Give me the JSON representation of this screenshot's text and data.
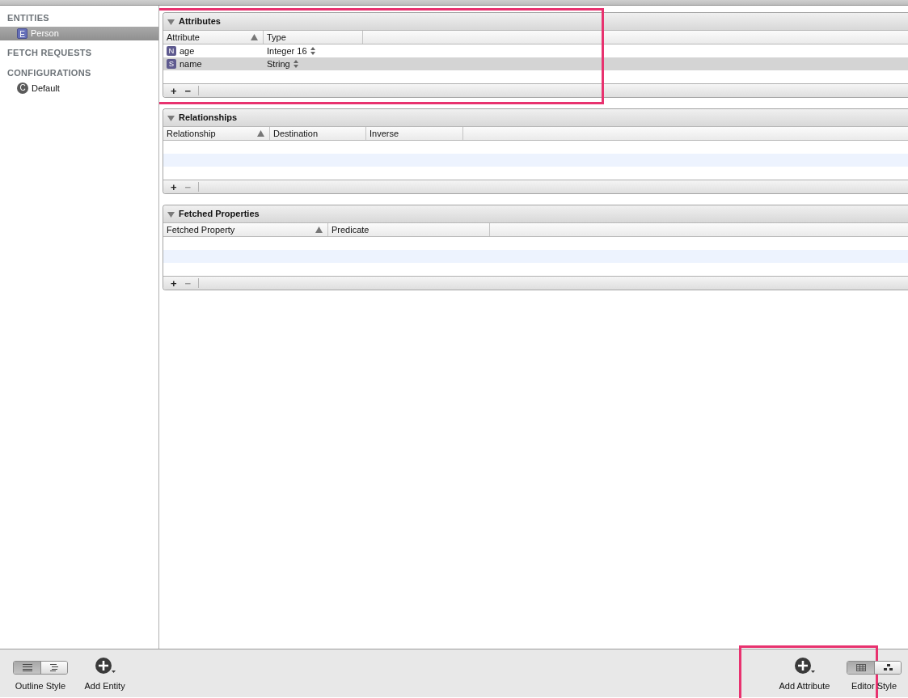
{
  "sidebar": {
    "sections": [
      {
        "title": "ENTITIES",
        "items": [
          {
            "badge": "E",
            "label": "Person",
            "selected": true
          }
        ]
      },
      {
        "title": "FETCH REQUESTS"
      },
      {
        "title": "CONFIGURATIONS",
        "items": [
          {
            "badge": "C",
            "label": "Default",
            "selected": false
          }
        ]
      }
    ]
  },
  "panels": [
    {
      "title": "Attributes",
      "expanded": true,
      "highlighted": true,
      "columns": [
        {
          "label": "Attribute",
          "sorted": true
        },
        {
          "label": "Type",
          "sorted": false
        }
      ],
      "rows": [
        {
          "badge": "N",
          "name": "age",
          "type": "Integer 16",
          "selected": false
        },
        {
          "badge": "S",
          "name": "name",
          "type": "String",
          "selected": true
        }
      ],
      "buttons": [
        {
          "label": "+",
          "disabled": false
        },
        {
          "label": "−",
          "disabled": false
        }
      ]
    },
    {
      "title": "Relationships",
      "expanded": true,
      "highlighted": false,
      "columns": [
        {
          "label": "Relationship",
          "sorted": true
        },
        {
          "label": "Destination",
          "sorted": false
        },
        {
          "label": "Inverse",
          "sorted": false
        }
      ],
      "buttons": [
        {
          "label": "+",
          "disabled": false
        },
        {
          "label": "−",
          "disabled": true
        }
      ]
    },
    {
      "title": "Fetched Properties",
      "expanded": true,
      "highlighted": false,
      "columns": [
        {
          "label": "Fetched Property",
          "sorted": true
        },
        {
          "label": "Predicate",
          "sorted": false
        }
      ],
      "buttons": [
        {
          "label": "+",
          "disabled": false
        },
        {
          "label": "−",
          "disabled": true
        }
      ]
    }
  ],
  "toolbar": {
    "left": [
      {
        "kind": "segmented",
        "label": "Outline Style",
        "highlighted": false,
        "segments": [
          {
            "selected": true
          },
          {
            "selected": false
          }
        ]
      },
      {
        "kind": "add",
        "label": "Add Entity",
        "highlighted": false
      }
    ],
    "right": [
      {
        "kind": "add",
        "label": "Add Attribute",
        "highlighted": true
      },
      {
        "kind": "segmented",
        "label": "Editor Style",
        "highlighted": false,
        "segments": [
          {
            "selected": true
          },
          {
            "selected": false
          }
        ]
      }
    ]
  }
}
